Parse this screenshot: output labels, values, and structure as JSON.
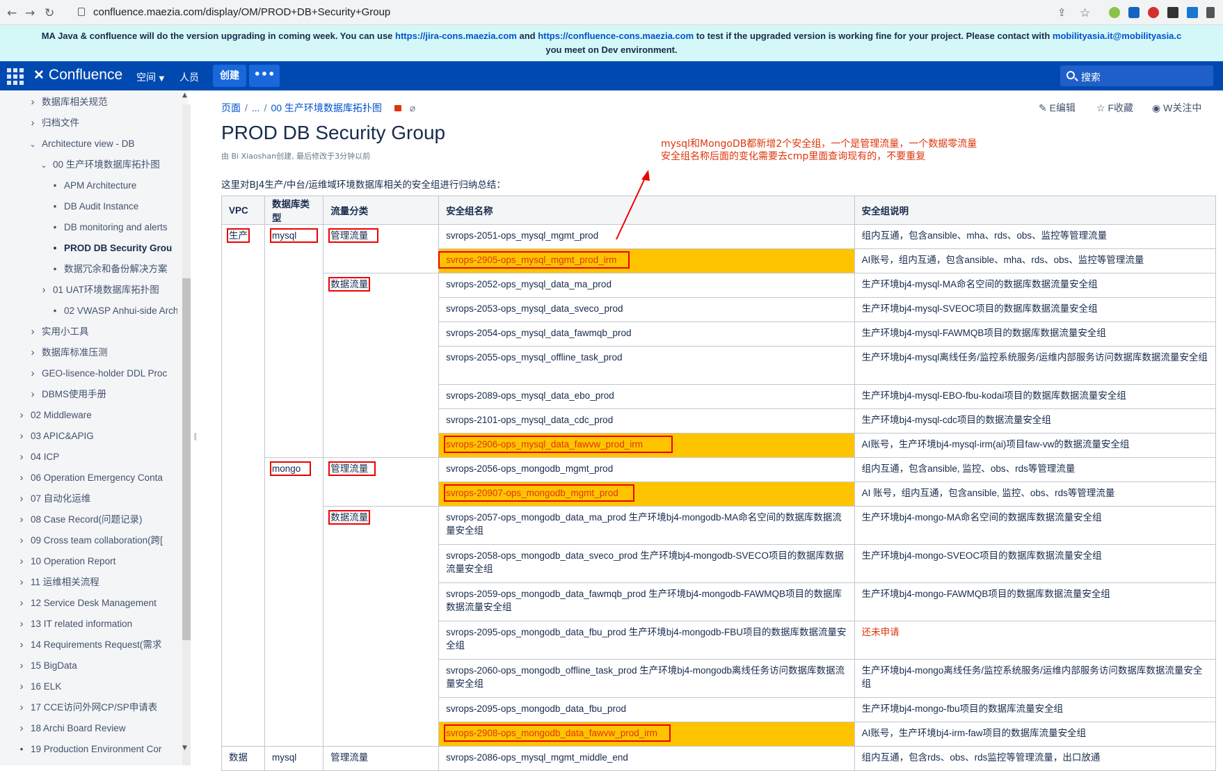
{
  "browser": {
    "url": "confluence.maezia.com/display/OM/PROD+DB+Security+Group"
  },
  "banner": {
    "line1_a": "MA Java & confluence will do the version upgrading in coming week.  You can use ",
    "link1": "https://jira-cons.maezia.com",
    "line1_b": " and ",
    "link2": "https://confluence-cons.maezia.com",
    "line1_c": " to test if the upgraded version is working fine for your project. Please contact with ",
    "link3": "mobilityasia.it@mobilityasia.c",
    "line2": "you meet on Dev environment."
  },
  "topnav": {
    "product": "Confluence",
    "spaces": "空间",
    "people": "人员",
    "create": "创建",
    "more": "•••",
    "search_placeholder": "搜索"
  },
  "sidebar": {
    "items": [
      {
        "label": "数据库相关规范",
        "icon": "chevron-right"
      },
      {
        "label": "归档文件",
        "icon": "chevron-right"
      },
      {
        "label": "Architecture view - DB",
        "icon": "chevron-down"
      },
      {
        "label": "00 生产环境数据库拓扑图",
        "icon": "chevron-down"
      },
      {
        "label": "APM Architecture",
        "icon": "bullet"
      },
      {
        "label": "DB Audit Instance",
        "icon": "bullet"
      },
      {
        "label": "DB monitoring and alerts",
        "icon": "bullet"
      },
      {
        "label": "PROD DB Security Grou",
        "icon": "bullet"
      },
      {
        "label": "数据冗余和备份解决方案",
        "icon": "bullet"
      },
      {
        "label": "01 UAT环境数据库拓扑图",
        "icon": "chevron-right"
      },
      {
        "label": "02 VWASP Anhui-side Arch",
        "icon": "bullet"
      },
      {
        "label": "实用小工具",
        "icon": "chevron-right"
      },
      {
        "label": "数据库标准压测",
        "icon": "chevron-right"
      },
      {
        "label": "GEO-lisence-holder DDL Proc",
        "icon": "chevron-right"
      },
      {
        "label": "DBMS使用手册",
        "icon": "chevron-right"
      },
      {
        "label": "02 Middleware",
        "icon": "chevron-right"
      },
      {
        "label": "03 APIC&APIG",
        "icon": "chevron-right"
      },
      {
        "label": "04 ICP",
        "icon": "chevron-right"
      },
      {
        "label": "06 Operation Emergency Conta",
        "icon": "chevron-right"
      },
      {
        "label": "07 自动化运维",
        "icon": "chevron-right"
      },
      {
        "label": "08 Case Record(问题记录)",
        "icon": "chevron-right"
      },
      {
        "label": "09 Cross team collaboration(跨[",
        "icon": "chevron-right"
      },
      {
        "label": "10 Operation Report",
        "icon": "chevron-right"
      },
      {
        "label": "11 运维相关流程",
        "icon": "chevron-right"
      },
      {
        "label": "12 Service Desk Management",
        "icon": "chevron-right"
      },
      {
        "label": "13 IT related information",
        "icon": "chevron-right"
      },
      {
        "label": "14 Requirements Request(需求",
        "icon": "chevron-right"
      },
      {
        "label": "15 BigData",
        "icon": "chevron-right"
      },
      {
        "label": "16 ELK",
        "icon": "chevron-right"
      },
      {
        "label": "17 CCE访问外网CP/SP申请表",
        "icon": "chevron-right"
      },
      {
        "label": "18 Archi Board Review",
        "icon": "chevron-right"
      },
      {
        "label": "19 Production Environment Cor",
        "icon": "bullet"
      }
    ]
  },
  "page": {
    "breadcrumb": [
      "页面",
      "...",
      "00 生产环境数据库拓扑图"
    ],
    "actions": {
      "edit": "E编辑",
      "star": "F收藏",
      "watch": "W关注中"
    },
    "title": "PROD DB Security Group",
    "byline": "由 Bi Xiaoshan创建, 最后修改于3分钟以前",
    "intro": "这里对BJ4生产/中台/运维域环境数据库相关的安全组进行归纳总结：",
    "annotation_line1": "mysql和MongoDB都新增2个安全组，一个是管理流量，一个数据零流量",
    "annotation_line2": "安全组名称后面的变化需要去cmp里面查询现有的，不要重复"
  },
  "table": {
    "headers": [
      "VPC",
      "数据库类型",
      "流量分类",
      "安全组名称",
      "安全组说明"
    ],
    "vpc_prod": "生产",
    "vpc_data": "数据",
    "db_mysql": "mysql",
    "db_mongo": "mongo",
    "db_mysql2": "mysql",
    "traffic_mgmt": "管理流量",
    "traffic_data": "数据流量",
    "traffic_mgmt_mongo": "管理流量",
    "traffic_data_mongo": "数据流量",
    "traffic_mgmt_last": "管理流量",
    "rows": [
      {
        "name": "svrops-2051-ops_mysql_mgmt_prod",
        "desc": "组内互通，包含ansible、mha、rds、obs、监控等管理流量"
      },
      {
        "name": "svrops-2905-ops_mysql_mgmt_prod_irm",
        "desc": "AI账号，组内互通，包含ansible、mha、rds、obs、监控等管理流量"
      },
      {
        "name": "svrops-2052-ops_mysql_data_ma_prod",
        "desc": "生产环境bj4-mysql-MA命名空间的数据库数据流量安全组"
      },
      {
        "name": "svrops-2053-ops_mysql_data_sveco_prod",
        "desc": "生产环境bj4-mysql-SVEOC项目的数据库数据流量安全组"
      },
      {
        "name": "svrops-2054-ops_mysql_data_fawmqb_prod",
        "desc": "生产环境bj4-mysql-FAWMQB项目的数据库数据流量安全组"
      },
      {
        "name": "svrops-2055-ops_mysql_offline_task_prod",
        "desc": "生产环境bj4-mysql离线任务/监控系统服务/运维内部服务访问数据库数据流量安全组"
      },
      {
        "name": "svrops-2089-ops_mysql_data_ebo_prod",
        "desc": "生产环境bj4-mysql-EBO-fbu-kodai项目的数据库数据流量安全组"
      },
      {
        "name": "svrops-2101-ops_mysql_data_cdc_prod",
        "desc": "生产环境bj4-mysql-cdc项目的数据流量安全组"
      },
      {
        "name": "svrops-2906-ops_mysql_data_fawvw_prod_irm",
        "desc": "AI账号，生产环境bj4-mysql-irm(ai)项目faw-vw的数据流量安全组"
      },
      {
        "name": "svrops-2056-ops_mongodb_mgmt_prod",
        "desc": "组内互通，包含ansible, 监控、obs、rds等管理流量"
      },
      {
        "name": "svrops-20907-ops_mongodb_mgmt_prod",
        "desc": "AI 账号，组内互通，包含ansible, 监控、obs、rds等管理流量"
      },
      {
        "name": "svrops-2057-ops_mongodb_data_ma_prod 生产环境bj4-mongodb-MA命名空间的数据库数据流量安全组",
        "desc": "生产环境bj4-mongo-MA命名空间的数据库数据流量安全组"
      },
      {
        "name": "svrops-2058-ops_mongodb_data_sveco_prod 生产环境bj4-mongodb-SVECO项目的数据库数据流量安全组",
        "desc": "生产环境bj4-mongo-SVEOC项目的数据库数据流量安全组"
      },
      {
        "name": "svrops-2059-ops_mongodb_data_fawmqb_prod 生产环境bj4-mongodb-FAWMQB项目的数据库数据流量安全组",
        "desc": "生产环境bj4-mongo-FAWMQB项目的数据库数据流量安全组"
      },
      {
        "name": "svrops-2095-ops_mongodb_data_fbu_prod 生产环境bj4-mongodb-FBU项目的数据库数据流量安全组",
        "desc": "还未申请"
      },
      {
        "name": "svrops-2060-ops_mongodb_offline_task_prod 生产环境bj4-mongodb离线任务访问数据库数据流量安全组",
        "desc": "生产环境bj4-mongo离线任务/监控系统服务/运维内部服务访问数据库数据流量安全组"
      },
      {
        "name": "svrops-2095-ops_mongodb_data_fbu_prod",
        "desc": "生产环境bj4-mongo-fbu项目的数据库流量安全组"
      },
      {
        "name": "svrops-2908-ops_mongodb_data_fawvw_prod_irm",
        "desc": "AI账号，生产环境bj4-irm-faw项目的数据库流量安全组"
      },
      {
        "name": "svrops-2086-ops_mysql_mgmt_middle_end",
        "desc": "组内互通，包含rds、obs、rds监控等管理流量，出口放通"
      }
    ]
  },
  "colors": {
    "topnav": "#0049b0",
    "banner": "#d4f7f7",
    "highlight": "#ffc400",
    "annotation": "#de350b"
  }
}
